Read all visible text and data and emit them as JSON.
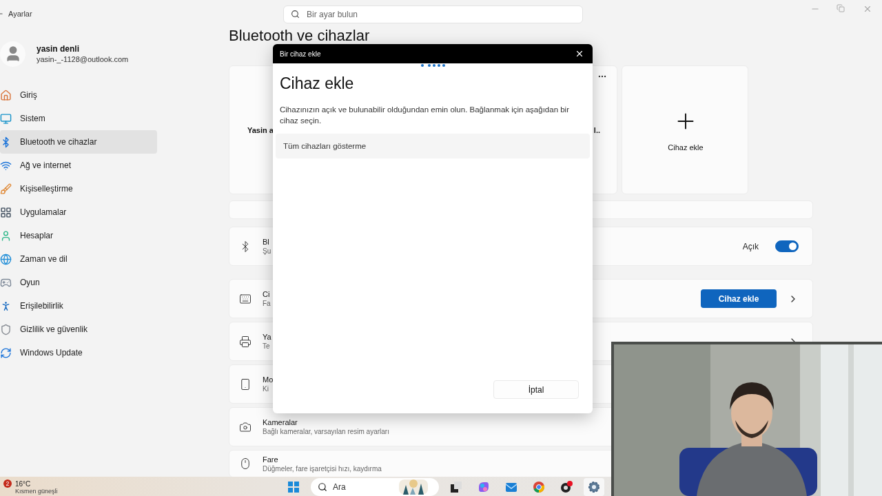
{
  "window": {
    "title": "Ayarlar"
  },
  "search": {
    "placeholder": "Bir ayar bulun"
  },
  "profile": {
    "name": "yasin denli",
    "email": "yasin-_-1128@outlook.com"
  },
  "sidebar": {
    "items": [
      {
        "label": "Giriş",
        "selected": false
      },
      {
        "label": "Sistem",
        "selected": false
      },
      {
        "label": "Bluetooth ve cihazlar",
        "selected": true
      },
      {
        "label": "Ağ ve internet",
        "selected": false
      },
      {
        "label": "Kişiselleştirme",
        "selected": false
      },
      {
        "label": "Uygulamalar",
        "selected": false
      },
      {
        "label": "Hesaplar",
        "selected": false
      },
      {
        "label": "Zaman ve dil",
        "selected": false
      },
      {
        "label": "Oyun",
        "selected": false
      },
      {
        "label": "Erişilebilirlik",
        "selected": false
      },
      {
        "label": "Gizlilik ve güvenlik",
        "selected": false
      },
      {
        "label": "Windows Update",
        "selected": false
      }
    ]
  },
  "page": {
    "title": "Bluetooth ve cihazlar"
  },
  "device_cards": [
    {
      "kind": "device",
      "name": "Yasin a"
    },
    {
      "kind": "device",
      "name": "l..",
      "menu": true
    },
    {
      "kind": "add",
      "label": "Cihaz ekle"
    }
  ],
  "rows": [
    {
      "kind": "toggle",
      "title": "Bl",
      "subtitle": "Şu",
      "state": "Açık",
      "on": true
    },
    {
      "kind": "button",
      "title": "Ci",
      "subtitle": "Fa",
      "button": "Cihaz ekle",
      "chevron": true
    },
    {
      "kind": "link",
      "title": "Ya",
      "subtitle": "Te",
      "chevron": true
    },
    {
      "kind": "link",
      "title": "Mo",
      "subtitle": "Ki"
    },
    {
      "kind": "link",
      "title": "Kameralar",
      "subtitle": "Bağlı kameralar, varsayılan resim ayarları"
    },
    {
      "kind": "link",
      "title": "Fare",
      "subtitle": "Düğmeler, fare işaretçisi hızı, kaydırma"
    }
  ],
  "dialog": {
    "window_title": "Bir cihaz ekle",
    "heading": "Cihaz ekle",
    "text": "Cihazınızın açık ve bulunabilir olduğundan emin olun. Bağlanmak için aşağıdan bir cihaz seçin.",
    "option": "Tüm cihazları gösterme",
    "cancel": "İptal"
  },
  "taskbar": {
    "weather_badge": "2",
    "temperature": "16°C",
    "weather": "Kısmen güneşli",
    "search_placeholder": "Ara"
  }
}
